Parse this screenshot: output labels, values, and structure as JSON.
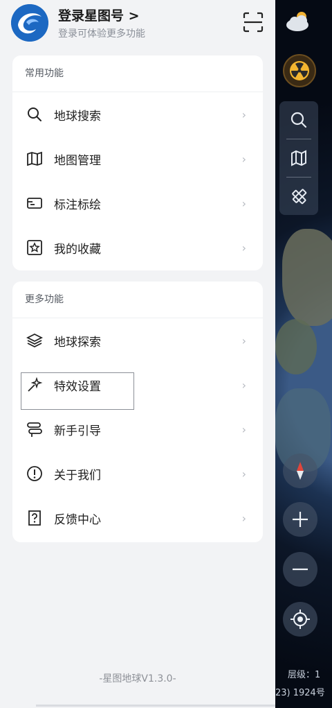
{
  "header": {
    "title": "登录星图号 >",
    "subtitle": "登录可体验更多功能"
  },
  "common": {
    "title": "常用功能",
    "items": [
      {
        "label": "地球搜索"
      },
      {
        "label": "地图管理"
      },
      {
        "label": "标注标绘"
      },
      {
        "label": "我的收藏"
      }
    ]
  },
  "more": {
    "title": "更多功能",
    "items": [
      {
        "label": "地球探索"
      },
      {
        "label": "特效设置"
      },
      {
        "label": "新手引导"
      },
      {
        "label": "关于我们"
      },
      {
        "label": "反馈中心"
      }
    ]
  },
  "footer": {
    "version": "-星图地球V1.3.0-"
  },
  "map": {
    "level_text": "层级：1",
    "sat_text": "23) 1924号"
  },
  "icons": {
    "chevron": "›"
  }
}
